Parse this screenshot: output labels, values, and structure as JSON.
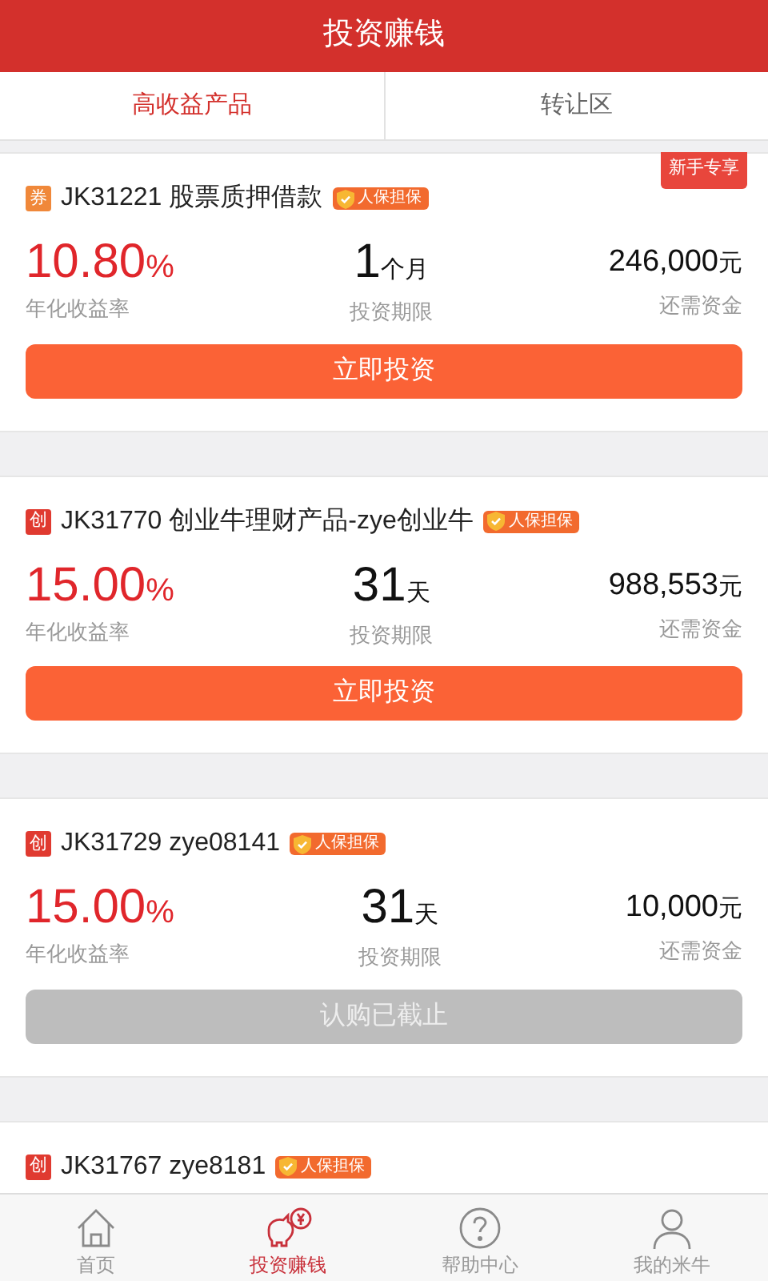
{
  "header": {
    "title": "投资赚钱"
  },
  "tabs": [
    {
      "label": "高收益产品",
      "selected": true
    },
    {
      "label": "转让区",
      "selected": false
    }
  ],
  "products": [
    {
      "tag": "券",
      "color": "#f0883a",
      "code_name": "JK31221 股票质押借款",
      "guarantee": "人保担保",
      "ribbon": "新手专享",
      "rate": "10.80",
      "rate_unit": "%",
      "rate_label": "年化收益率",
      "term": "1",
      "term_unit": "个月",
      "term_label": "投资期限",
      "amount": "246,000",
      "amount_unit": "元",
      "amount_label": "还需资金",
      "button": "立即投资",
      "disabled": false
    },
    {
      "tag": "创",
      "color": "#e03a30",
      "code_name": "JK31770 创业牛理财产品-zye创业牛",
      "guarantee": "人保担保",
      "rate": "15.00",
      "rate_unit": "%",
      "rate_label": "年化收益率",
      "term": "31",
      "term_unit": "天",
      "term_label": "投资期限",
      "amount": "988,553",
      "amount_unit": "元",
      "amount_label": "还需资金",
      "button": "立即投资",
      "disabled": false
    },
    {
      "tag": "创",
      "color": "#e03a30",
      "code_name": "JK31729 zye08141",
      "guarantee": "人保担保",
      "rate": "15.00",
      "rate_unit": "%",
      "rate_label": "年化收益率",
      "term": "31",
      "term_unit": "天",
      "term_label": "投资期限",
      "amount": "10,000",
      "amount_unit": "元",
      "amount_label": "还需资金",
      "button": "认购已截止",
      "disabled": true
    },
    {
      "tag": "创",
      "color": "#e03a30",
      "code_name": "JK31767 zye8181",
      "guarantee": "人保担保"
    }
  ],
  "bottom_nav": [
    {
      "kind": "home",
      "label": "首页",
      "selected": false
    },
    {
      "kind": "invest",
      "label": "投资赚钱",
      "selected": true
    },
    {
      "kind": "help",
      "label": "帮助中心",
      "selected": false
    },
    {
      "kind": "account",
      "label": "我的米牛",
      "selected": false
    }
  ]
}
